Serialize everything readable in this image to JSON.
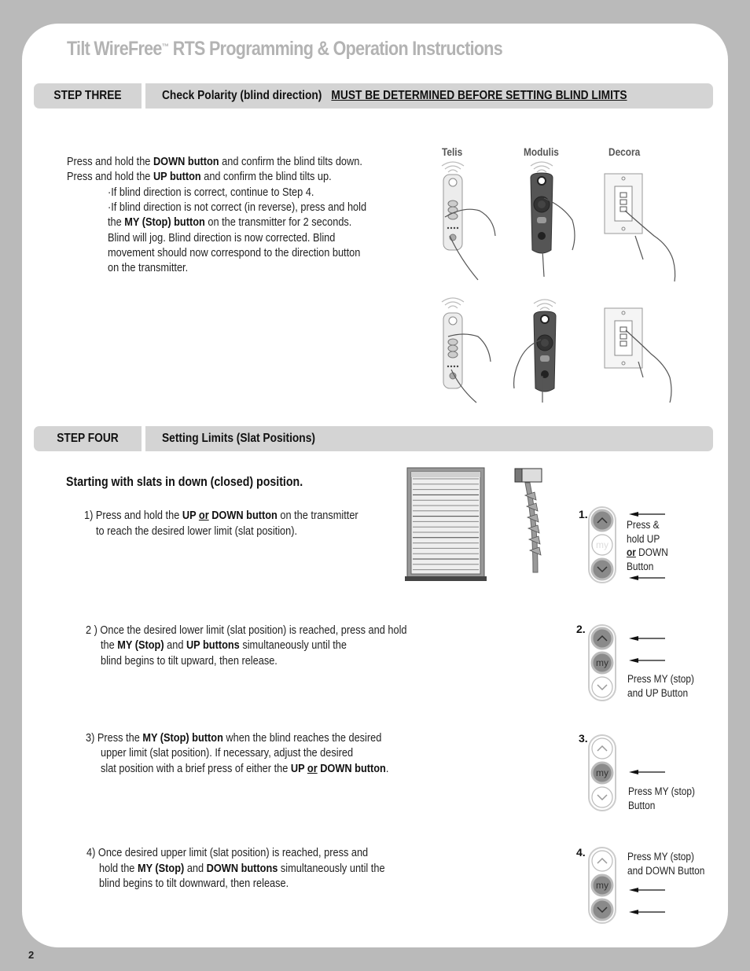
{
  "document": {
    "title": "Tilt WireFree",
    "title_tm": "™",
    "title_rest": " RTS Programming & Operation Instructions",
    "page_number": "2"
  },
  "step_three": {
    "label": "STEP THREE",
    "heading": "Check Polarity (blind direction)",
    "warning": "MUST BE DETERMINED BEFORE SETTING BLIND LIMITS",
    "lines": [
      {
        "pre": "Press and hold the ",
        "bold": "DOWN button",
        "post": " and confirm the blind tilts down."
      },
      {
        "pre": "Press and hold the ",
        "bold": "UP button",
        "post": " and confirm the blind tilts up."
      },
      {
        "pre": "·If blind direction is correct, continue to Step 4."
      },
      {
        "pre": "·If blind direction is not correct (in reverse), press and hold"
      },
      {
        "pre": " the ",
        "bold": "MY (Stop) button",
        "post": " on the transmitter for 2 seconds."
      },
      {
        "pre": " Blind will jog. Blind direction is now corrected. Blind"
      },
      {
        "pre": " movement should now correspond to the direction button"
      },
      {
        "pre": " on the transmitter."
      }
    ],
    "transmitters": [
      "Telis",
      "Modulis",
      "Decora"
    ]
  },
  "step_four": {
    "label": "STEP FOUR",
    "heading": "Setting Limits (Slat Positions)",
    "subheading": "Starting with slats in down (closed) position.",
    "instructions": [
      {
        "line1": {
          "pre": "1) Press and hold the ",
          "b1": "UP ",
          "u": "or",
          "b2": " DOWN button",
          "post": " on the transmitter"
        },
        "line2": "to reach the desired lower  limit (slat position)."
      },
      {
        "line1": "2 ) Once the desired lower limit (slat position) is reached, press and hold",
        "line2": {
          "pre": "the ",
          "b1": "MY (Stop)",
          "mid": " and ",
          "b2": "UP buttons",
          "post": " simultaneously until the"
        },
        "line3": "blind begins to tilt upward, then release."
      },
      {
        "line1": {
          "pre": "3) Press the ",
          "b1": "MY (Stop) button",
          "post": " when the blind reaches the desired"
        },
        "line2": "upper limit (slat position). If necessary, adjust the desired",
        "line3": {
          "pre": "slat position with a brief press of either the ",
          "b1": "UP ",
          "u": "or",
          "b2": " DOWN button",
          "post": "."
        }
      },
      {
        "line1": "4) Once desired upper limit (slat position) is reached, press and",
        "line2": {
          "pre": "hold the ",
          "b1": "MY (Stop)",
          "mid": " and ",
          "b2": "DOWN buttons",
          "post": " simultaneously until the"
        },
        "line3": "blind begins to tilt downward, then release."
      }
    ],
    "diagrams": [
      {
        "number": "1.",
        "caption": [
          "Press &",
          "hold UP",
          "or DOWN",
          "Button"
        ],
        "highlight": [
          "up",
          "down"
        ]
      },
      {
        "number": "2.",
        "caption": [
          "Press MY (stop)",
          "and UP Button"
        ],
        "highlight": [
          "up",
          "my"
        ]
      },
      {
        "number": "3.",
        "caption": [
          "Press MY (stop)",
          "Button"
        ],
        "highlight": [
          "my"
        ]
      },
      {
        "number": "4.",
        "caption": [
          "Press MY (stop)",
          "and DOWN Button"
        ],
        "highlight": [
          "my",
          "down"
        ]
      }
    ],
    "button_my_label": "my"
  }
}
